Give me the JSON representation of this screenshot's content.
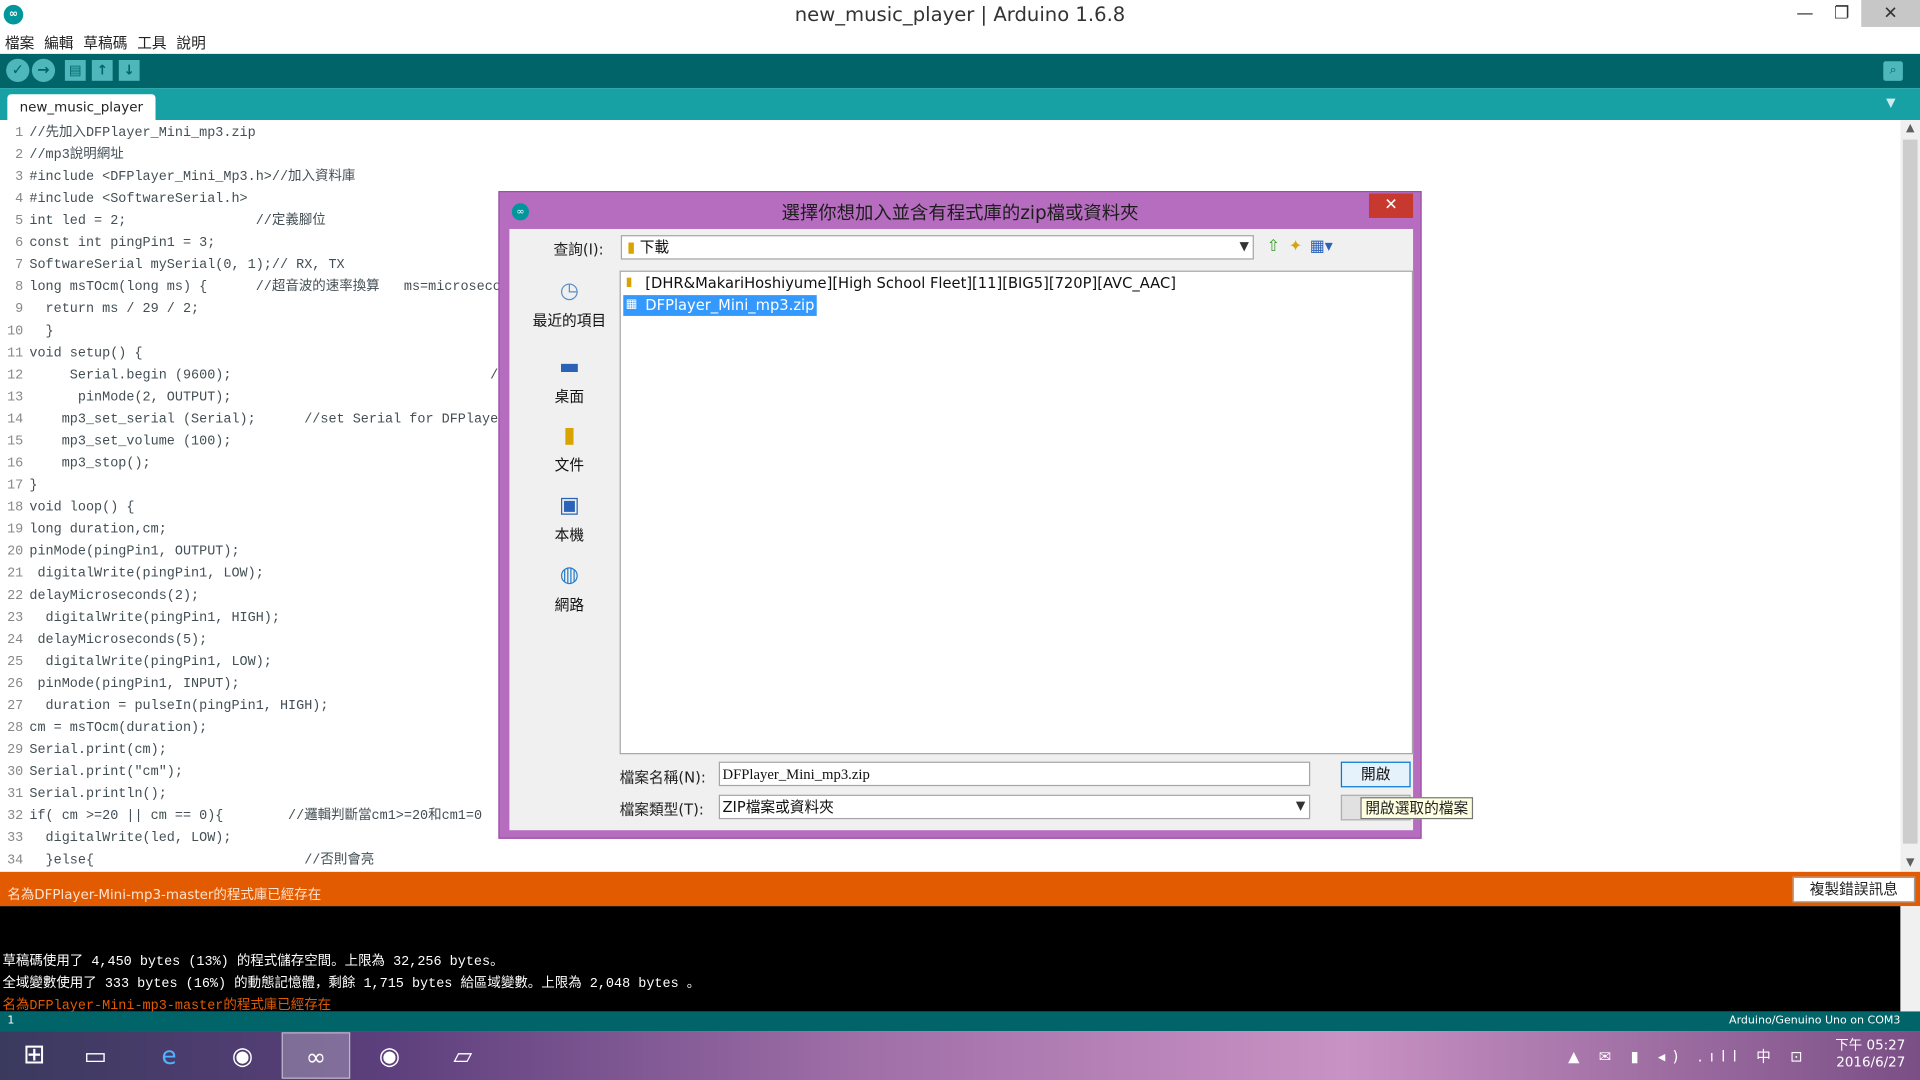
{
  "window": {
    "title": "new_music_player | Arduino 1.6.8",
    "minimize": "—",
    "maximize": "❐",
    "close": "✕"
  },
  "menu": [
    "檔案",
    "編輯",
    "草稿碼",
    "工具",
    "說明"
  ],
  "toolbar": {
    "verify_icon": "check-icon",
    "upload_icon": "arrow-right-icon",
    "new_icon": "new-file-icon",
    "open_icon": "open-icon",
    "save_icon": "save-icon",
    "serial_monitor_icon": "magnifier-icon"
  },
  "tab": {
    "label": "new_music_player"
  },
  "editor": {
    "lines": [
      {
        "n": "1",
        "t": "//先加入DFPlayer_Mini_mp3.zip"
      },
      {
        "n": "2",
        "t": "//mp3說明網址"
      },
      {
        "n": "3",
        "t": "#include <DFPlayer_Mini_Mp3.h>//加入資料庫"
      },
      {
        "n": "4",
        "t": "#include <SoftwareSerial.h>"
      },
      {
        "n": "5",
        "t": "int led = 2;                //定義腳位"
      },
      {
        "n": "6",
        "t": "const int pingPin1 = 3;"
      },
      {
        "n": "7",
        "t": "SoftwareSerial mySerial(0, 1);// RX, TX"
      },
      {
        "n": "8",
        "t": "long msTOcm(long ms) {      //超音波的速率換算   ms=microsecond(微秒)"
      },
      {
        "n": "9",
        "t": "  return ms / 29 / 2;"
      },
      {
        "n": "10",
        "t": "  }"
      },
      {
        "n": "11",
        "t": "void setup() {"
      },
      {
        "n": "12",
        "t": "     Serial.begin (9600);                                //uno傳輸率"
      },
      {
        "n": "13",
        "t": "      pinMode(2, OUTPUT);"
      },
      {
        "n": "14",
        "t": "    mp3_set_serial (Serial);      //set Serial for DFPlayer-mini mp3"
      },
      {
        "n": "15",
        "t": "    mp3_set_volume (100);"
      },
      {
        "n": "16",
        "t": "    mp3_stop();"
      },
      {
        "n": "17",
        "t": "}"
      },
      {
        "n": "18",
        "t": "void loop() {"
      },
      {
        "n": "19",
        "t": "long duration,cm;"
      },
      {
        "n": "20",
        "t": "pinMode(pingPin1, OUTPUT);"
      },
      {
        "n": "21",
        "t": " digitalWrite(pingPin1, LOW);"
      },
      {
        "n": "22",
        "t": "delayMicroseconds(2);"
      },
      {
        "n": "23",
        "t": "  digitalWrite(pingPin1, HIGH);"
      },
      {
        "n": "24",
        "t": " delayMicroseconds(5);"
      },
      {
        "n": "25",
        "t": "  digitalWrite(pingPin1, LOW);"
      },
      {
        "n": "26",
        "t": " pinMode(pingPin1, INPUT);"
      },
      {
        "n": "27",
        "t": "  duration = pulseIn(pingPin1, HIGH);"
      },
      {
        "n": "28",
        "t": "cm = msTOcm(duration);"
      },
      {
        "n": "29",
        "t": "Serial.print(cm);"
      },
      {
        "n": "30",
        "t": "Serial.print(\"cm\");"
      },
      {
        "n": "31",
        "t": "Serial.println();"
      },
      {
        "n": "32",
        "t": "if( cm >=20 || cm == 0){        //邏輯判斷當cm1>=20和cm1=0  LED不會亮"
      },
      {
        "n": "33",
        "t": "  digitalWrite(led, LOW);"
      },
      {
        "n": "34",
        "t": "  }else{                          //否則會亮"
      }
    ]
  },
  "message_bar": {
    "text": "名為DFPlayer-Mini-mp3-master的程式庫已經存在",
    "copy_button": "複製錯誤訊息"
  },
  "console": {
    "lines": [
      "草稿碼使用了 4,450 bytes (13%) 的程式儲存空間。上限為 32,256 bytes。",
      "全域變數使用了 333 bytes (16%) 的動態記憶體，剩餘 1,715 bytes 給區域變數。上限為 2,048 bytes 。",
      "名為DFPlayer-Mini-mp3-master的程式庫已經存在"
    ],
    "error_color": "#e35b00"
  },
  "status": {
    "line": "1",
    "board": "Arduino/Genuino Uno on COM3"
  },
  "dialog": {
    "title": "選擇你想加入並含有程式庫的zip檔或資料夾",
    "close": "✕",
    "lookin_label": "查詢(I):",
    "lookin_value": "下載",
    "places": [
      {
        "label": "最近的項目",
        "icon": "recent-items-icon"
      },
      {
        "label": "桌面",
        "icon": "desktop-icon"
      },
      {
        "label": "文件",
        "icon": "documents-icon"
      },
      {
        "label": "本機",
        "icon": "computer-icon"
      },
      {
        "label": "網路",
        "icon": "network-icon"
      }
    ],
    "files": [
      {
        "name": "[DHR&MakariHoshiyume][High School Fleet][11][BIG5][720P][AVC_AAC]",
        "type": "folder"
      },
      {
        "name": "DFPlayer_Mini_mp3.zip",
        "type": "zip",
        "selected": true
      }
    ],
    "filename_label": "檔案名稱(N):",
    "filename_value": "DFPlayer_Mini_mp3.zip",
    "filetype_label": "檔案類型(T):",
    "filetype_value": "ZIP檔案或資料夾",
    "open_button": "開啟",
    "cancel_button": "取",
    "tooltip": "開啟選取的檔案"
  },
  "taskbar": {
    "items": [
      "windows-start-icon",
      "file-explorer-icon",
      "internet-explorer-icon",
      "chrome-icon",
      "arduino-icon",
      "chrome-profile-icon",
      "app-icon"
    ],
    "time": "下午 05:27",
    "date": "2016/6/27",
    "tray": "▲ ✉ ▮ ◂) .ıll 中 ⊡"
  },
  "colors": {
    "teal_dark": "#006468",
    "teal": "#17a1a5",
    "orange": "#e35b00",
    "dialog_frame": "#b66dc0"
  }
}
